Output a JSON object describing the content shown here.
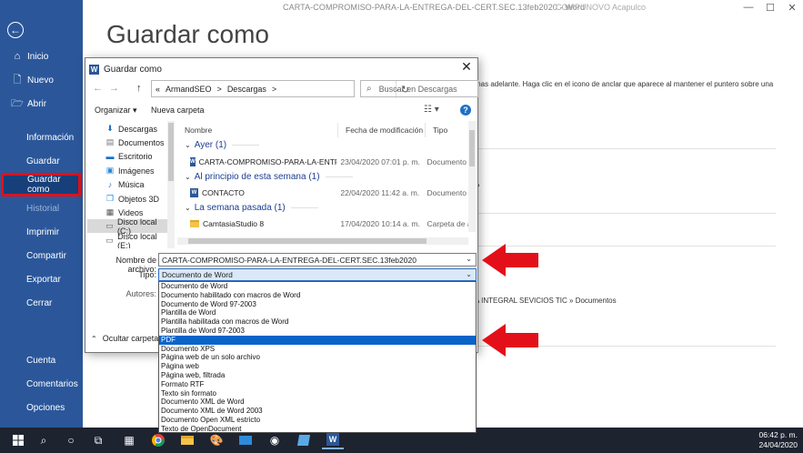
{
  "window": {
    "doc_title": "CARTA-COMPROMISO-PARA-LA-ENTREGA-DEL-CERT.SEC.13feb2020  -  Word",
    "user": "COMPUNOVO Acapulco",
    "minimize": "—",
    "maximize": "☐",
    "close": "✕"
  },
  "backstage": {
    "back_icon": "back-arrow-icon",
    "items": [
      {
        "label": "Inicio",
        "icon": "⌂"
      },
      {
        "label": "Nuevo",
        "icon": "🗋"
      },
      {
        "label": "Abrir",
        "icon": "🗁"
      }
    ],
    "info": "Información",
    "save": "Guardar",
    "save_as": "Guardar como",
    "history": "Historial",
    "print": "Imprimir",
    "share": "Compartir",
    "export": "Exportar",
    "close": "Cerrar",
    "account": "Cuenta",
    "comments": "Comentarios",
    "options": "Opciones"
  },
  "main": {
    "title": "Guardar como",
    "pin_hint": "mas adelante. Haga clic en el icono de anclar que aparece al mantener el puntero sobre una",
    "fragment_p": "P",
    "path": "A INTEGRAL SEVICIOS TIC » Documentos"
  },
  "dialog": {
    "title": "Guardar como",
    "close": "✕",
    "back": "←",
    "forward": "→",
    "up": "↑",
    "address": [
      "«",
      "ArmandSEO",
      ">",
      "Descargas",
      ">"
    ],
    "address_dropdown": "⌄",
    "refresh": "↻",
    "search_placeholder": "Buscar en Descargas",
    "organize": "Organizar ▾",
    "new_folder": "Nueva carpeta",
    "view": "☷ ▾",
    "help": "?",
    "tree": [
      {
        "label": "Descargas",
        "icon": "⬇",
        "color": "#1f6fc5"
      },
      {
        "label": "Documentos",
        "icon": "▤",
        "color": "#777"
      },
      {
        "label": "Escritorio",
        "icon": "▬",
        "color": "#1f6fc5"
      },
      {
        "label": "Imágenes",
        "icon": "▣",
        "color": "#2b8ad8"
      },
      {
        "label": "Música",
        "icon": "♪",
        "color": "#1f6fc5"
      },
      {
        "label": "Objetos 3D",
        "icon": "❒",
        "color": "#2b8ad8"
      },
      {
        "label": "Videos",
        "icon": "▦",
        "color": "#555"
      },
      {
        "label": "Disco local (C:)",
        "icon": "▭",
        "color": "#666"
      },
      {
        "label": "Disco local (E:)",
        "icon": "▭",
        "color": "#666"
      }
    ],
    "columns": [
      "Nombre",
      "Fecha de modificación",
      "Tipo"
    ],
    "groups": [
      {
        "label": "Ayer (1)",
        "files": [
          {
            "name": "CARTA-COMPROMISO-PARA-LA-ENTRE...",
            "date": "23/04/2020 07:01 p. m.",
            "type": "Documento d",
            "kind": "word"
          }
        ]
      },
      {
        "label": "Al principio de esta semana (1)",
        "files": [
          {
            "name": "CONTACTO",
            "date": "22/04/2020 11:42 a. m.",
            "type": "Documento d",
            "kind": "word"
          }
        ]
      },
      {
        "label": "La semana pasada (1)",
        "files": [
          {
            "name": "CamtasiaStudio 8",
            "date": "17/04/2020 10:14 a. m.",
            "type": "Carpeta de ar",
            "kind": "folder"
          }
        ]
      }
    ],
    "filename_label": "Nombre de archivo:",
    "filename_value": "CARTA-COMPROMISO-PARA-LA-ENTREGA-DEL-CERT.SEC.13feb2020",
    "type_label": "Tipo:",
    "type_value": "Documento de Word",
    "authors_label": "Autores:",
    "hide_folders": "Ocultar carpetas",
    "type_options": [
      "Documento de Word",
      "Documento habilitado con macros de Word",
      "Documento de Word 97-2003",
      "Plantilla de Word",
      "Plantilla habilitada con macros de Word",
      "Plantilla de Word 97-2003",
      "PDF",
      "Documento XPS",
      "Página web de un solo archivo",
      "Página web",
      "Página web, filtrada",
      "Formato RTF",
      "Texto sin formato",
      "Documento XML de Word",
      "Documento XML de Word 2003",
      "Documento Open XML estricto",
      "Texto de OpenDocument"
    ],
    "selected_option": "PDF"
  },
  "taskbar": {
    "time": "06:42 p. m.",
    "date": "24/04/2020"
  },
  "colors": {
    "word_blue": "#2b579a",
    "highlight_red": "#e3101a",
    "selection_blue": "#0a64c8"
  }
}
